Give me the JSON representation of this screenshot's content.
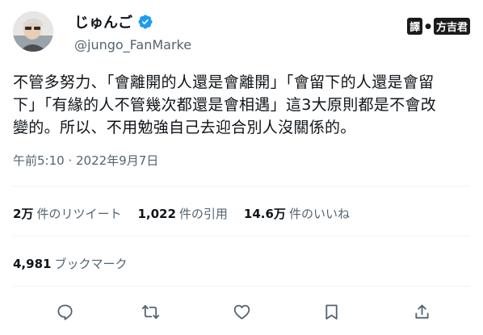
{
  "author": {
    "display_name": "じゅんご",
    "handle": "@jungo_FanMarke",
    "verified": true
  },
  "watermark": {
    "left_label": "譯",
    "right_label": "方吉君"
  },
  "tweet": {
    "lines": [
      "不管多努力、「會離開的人還是會離開」「會留下的人還是會留",
      "下」「有緣的人不管幾次都還是會相遇」這3大原則都是不會改",
      "變的。所以、不用勉強自己去迎合別人沒關係的。"
    ],
    "timestamp": "午前5:10 · 2022年9月7日"
  },
  "stats": {
    "retweets": {
      "num": "2万",
      "label": "件のリツイート"
    },
    "quotes": {
      "num": "1,022",
      "label": "件の引用"
    },
    "likes": {
      "num": "14.6万",
      "label": "件のいいね"
    },
    "bookmarks": {
      "num": "4,981",
      "label": "ブックマーク"
    }
  },
  "actions": [
    "reply-icon",
    "retweet-icon",
    "like-icon",
    "bookmark-icon",
    "share-icon"
  ],
  "colors": {
    "text": "#0f1419",
    "secondary": "#536471",
    "verified": "#1d9bf0",
    "divider": "#eff3f4"
  }
}
